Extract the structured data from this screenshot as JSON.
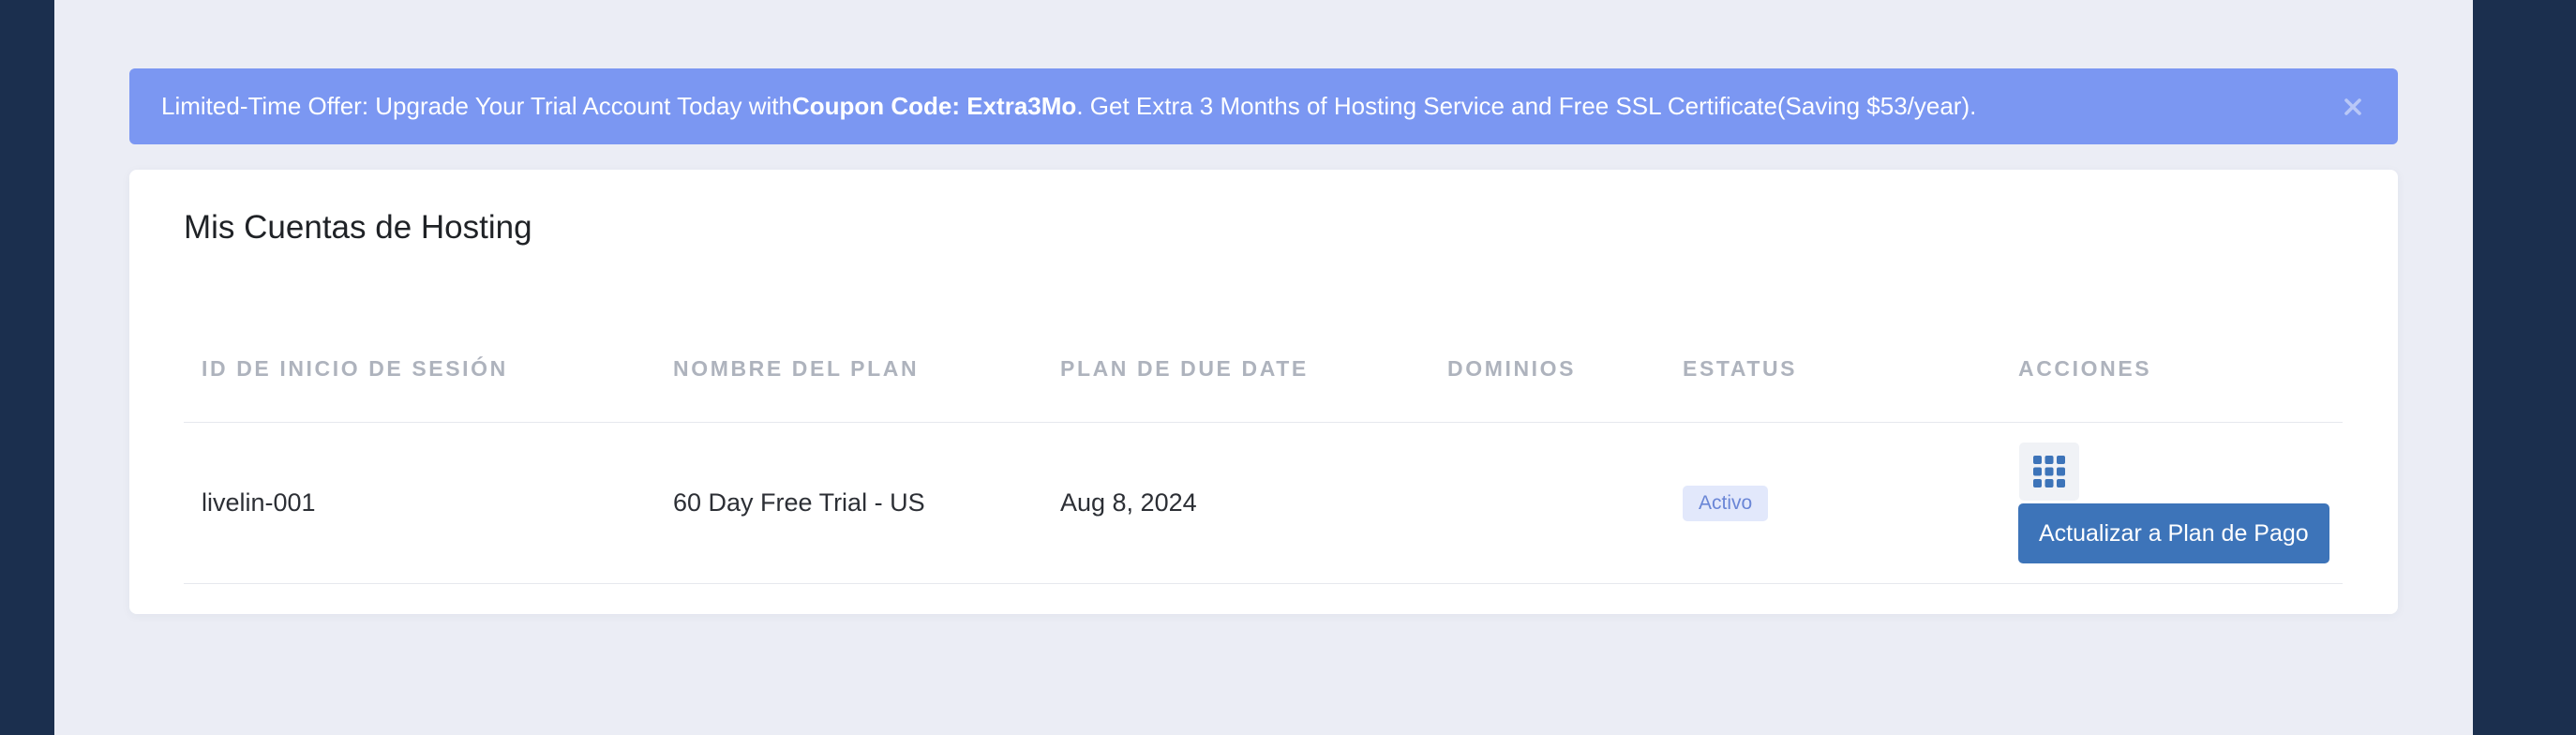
{
  "banner": {
    "text_before": "Limited-Time Offer: Upgrade Your Trial Account Today with ",
    "coupon": "Coupon Code: Extra3Mo",
    "text_after": ". Get Extra 3 Months of Hosting Service and Free SSL Certificate(Saving $53/year).",
    "close_icon": "close-icon",
    "background_color": "#7b97f2"
  },
  "card": {
    "title": "Mis Cuentas de Hosting"
  },
  "table": {
    "columns": [
      "ID DE INICIO DE SESIÓN",
      "NOMBRE DEL PLAN",
      "PLAN DE DUE DATE",
      "DOMINIOS",
      "ESTATUS",
      "ACCIONES"
    ],
    "rows": [
      {
        "login_id": "livelin-001",
        "plan_name": "60 Day Free Trial - US",
        "due_date": "Aug 8, 2024",
        "domains": "",
        "status": "Activo",
        "actions": {
          "grid_icon": "grid-icon",
          "upgrade_label": "Actualizar a Plan de Pago"
        }
      }
    ]
  },
  "colors": {
    "sidebar_dark": "#1b2f4e",
    "page_background": "#ebedf5",
    "accent_button": "#3d74b9",
    "status_badge_bg": "#e2e8fb",
    "status_badge_text": "#6a86d6"
  }
}
